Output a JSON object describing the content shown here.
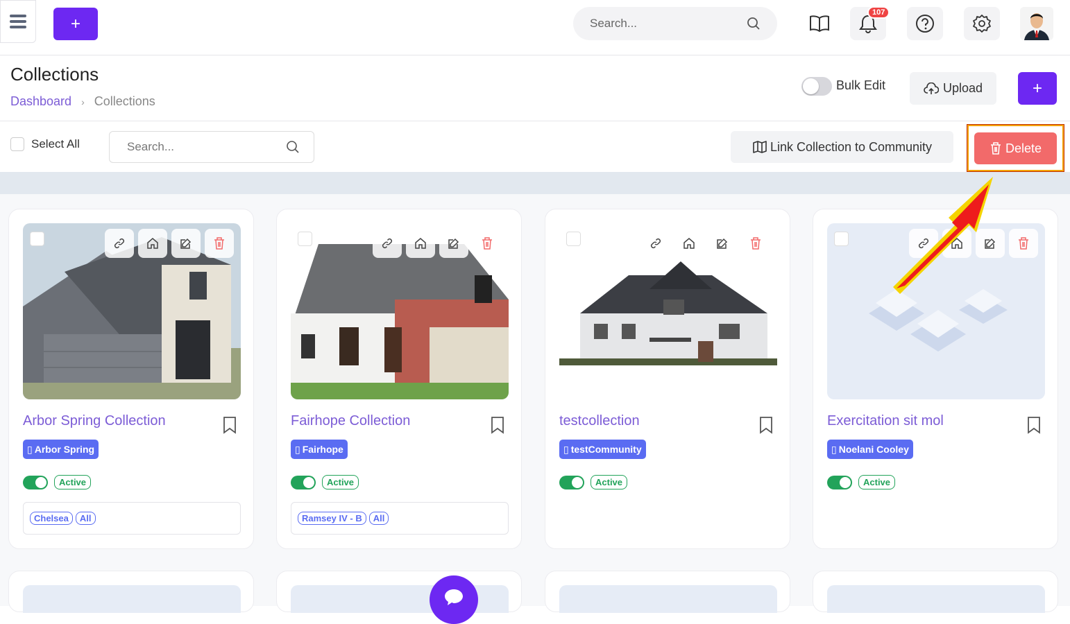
{
  "topbar": {
    "search_placeholder": "Search...",
    "notification_count": "107"
  },
  "page": {
    "title": "Collections",
    "breadcrumb": {
      "root": "Dashboard",
      "separator": "›",
      "current": "Collections"
    }
  },
  "toolbar": {
    "bulk_edit_label": "Bulk Edit",
    "upload_label": "Upload",
    "select_all_label": "Select All",
    "filter_search_placeholder": "Search...",
    "link_button_label": "Link Collection to Community",
    "delete_label": "Delete"
  },
  "colors": {
    "accent": "#6d28f2",
    "danger": "#f26a6a",
    "link": "#7c5cd6",
    "success": "#22a35a",
    "community_badge": "#5a6cf2"
  },
  "cards": [
    {
      "title": "Arbor Spring Collection",
      "community": "Arbor Spring",
      "status": "Active",
      "plans": [
        "Chelsea",
        "All"
      ],
      "image": "modern-house"
    },
    {
      "title": "Fairhope Collection",
      "community": "Fairhope",
      "status": "Active",
      "plans": [
        "Ramsey IV - B",
        "All"
      ],
      "image": "brick-house"
    },
    {
      "title": "testcollection",
      "community": "testCommunity",
      "status": "Active",
      "plans": [],
      "image": "two-story-house"
    },
    {
      "title": "Exercitation sit mol",
      "community": "Noelani Cooley",
      "status": "Active",
      "plans": [],
      "image": "placeholder-houses"
    }
  ]
}
